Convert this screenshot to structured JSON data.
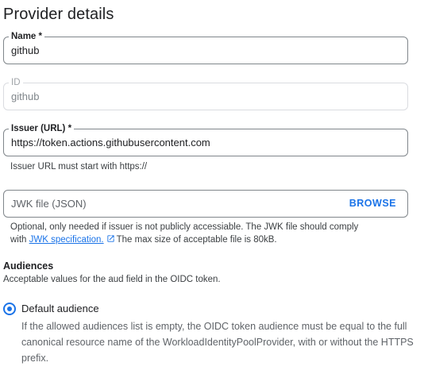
{
  "page": {
    "title": "Provider details"
  },
  "name_field": {
    "label": "Name *",
    "value": "github"
  },
  "id_field": {
    "label": "ID",
    "value": "github"
  },
  "issuer_field": {
    "label": "Issuer (URL) *",
    "value": "https://token.actions.githubusercontent.com",
    "hint": "Issuer URL must start with https://"
  },
  "jwk_field": {
    "placeholder": "JWK file (JSON)",
    "browse_label": "BROWSE",
    "hint_line1": "Optional, only needed if issuer is not publicly accessiable. The JWK file should comply",
    "hint_prefix": "with",
    "hint_link": "JWK specification.",
    "hint_suffix": "The max size of acceptable file is 80kB."
  },
  "audiences": {
    "title": "Audiences",
    "description": "Acceptable values for the aud field in the OIDC token.",
    "default_option": {
      "label": "Default audience",
      "description": "If the allowed audiences list is empty, the OIDC token audience must be equal to the full canonical resource name of the WorkloadIdentityPoolProvider, with or without the HTTPS prefix."
    }
  },
  "colors": {
    "accent": "#1a73e8",
    "border": "#80868b",
    "disabled_border": "#dadce0"
  },
  "icons": {
    "external_link": "external-link-icon"
  }
}
